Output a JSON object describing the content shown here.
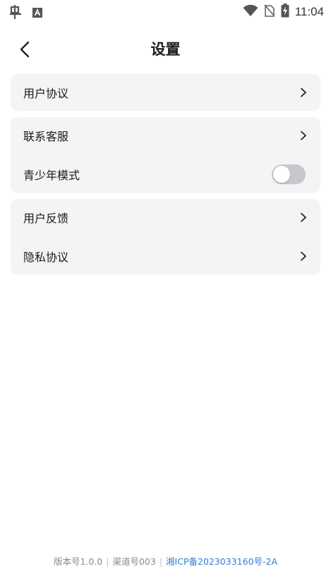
{
  "status_bar": {
    "time": "11:04",
    "left_icons": [
      "app-logo-icon",
      "keyboard-a-icon"
    ],
    "right_icons": [
      "wifi-icon",
      "no-sim-icon",
      "battery-charging-icon"
    ]
  },
  "header": {
    "title": "设置",
    "back_icon": "chevron-left-icon"
  },
  "groups": [
    {
      "items": [
        {
          "label": "用户协议",
          "type": "link"
        }
      ]
    },
    {
      "items": [
        {
          "label": "联系客服",
          "type": "link"
        },
        {
          "label": "青少年模式",
          "type": "toggle",
          "on": false
        }
      ]
    },
    {
      "items": [
        {
          "label": "用户反馈",
          "type": "link"
        },
        {
          "label": "隐私协议",
          "type": "link"
        }
      ]
    }
  ],
  "footer": {
    "version": "版本号1.0.0",
    "channel": "渠道号003",
    "icp": "湘ICP备2023033160号-2A"
  },
  "colors": {
    "card_bg": "#f4f4f6",
    "icp_link": "#2f7fd8",
    "toggle_off": "#c8c8cc"
  }
}
